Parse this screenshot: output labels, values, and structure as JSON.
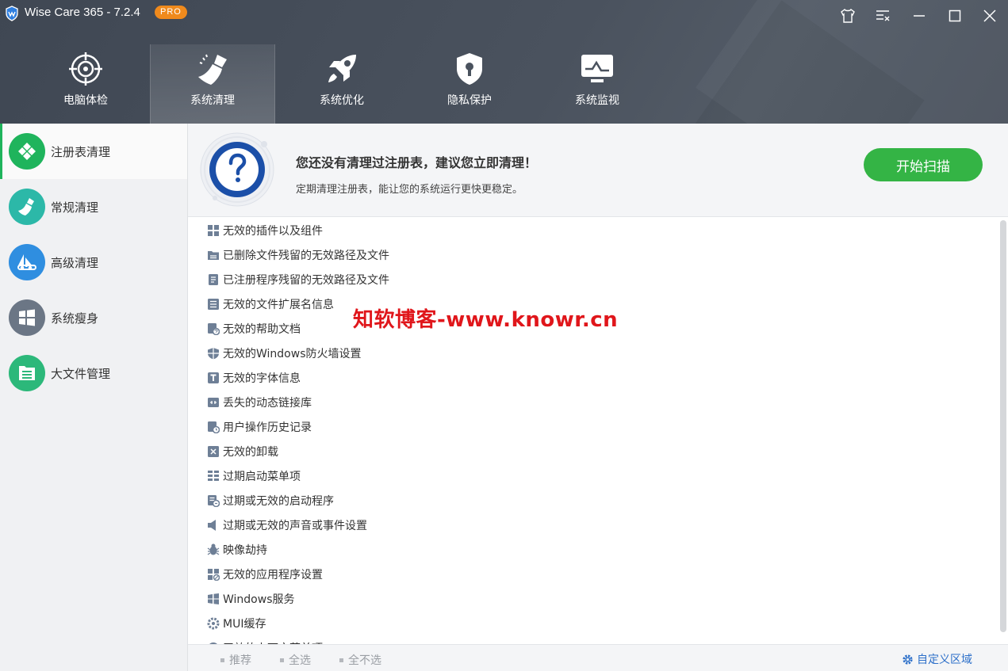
{
  "app": {
    "title": "Wise Care 365 - 7.2.4",
    "badge": "PRO"
  },
  "window_buttons": [
    "skin-icon",
    "menu-icon",
    "minimize-icon",
    "maximize-icon",
    "close-icon"
  ],
  "nav": {
    "tabs": [
      {
        "label": "电脑体检",
        "icon": "target-icon",
        "active": false
      },
      {
        "label": "系统清理",
        "icon": "broom-icon",
        "active": true
      },
      {
        "label": "系统优化",
        "icon": "rocket-icon",
        "active": false
      },
      {
        "label": "隐私保护",
        "icon": "shield-lock-icon",
        "active": false
      },
      {
        "label": "系统监视",
        "icon": "monitor-icon",
        "active": false
      }
    ]
  },
  "sidebar": {
    "items": [
      {
        "label": "注册表清理",
        "color": "#1fb45c",
        "active": true
      },
      {
        "label": "常规清理",
        "color": "#2cb8a8",
        "active": false
      },
      {
        "label": "高级清理",
        "color": "#2f8ee0",
        "active": false
      },
      {
        "label": "系统瘦身",
        "color": "#6b7685",
        "active": false
      },
      {
        "label": "大文件管理",
        "color": "#2cb87a",
        "active": false
      }
    ]
  },
  "banner": {
    "title": "您还没有清理过注册表，建议您立即清理！",
    "subtitle": "定期清理注册表，能让您的系统运行更快更稳定。",
    "scan_button": "开始扫描"
  },
  "items": [
    "无效的插件以及组件",
    "已删除文件残留的无效路径及文件",
    "已注册程序残留的无效路径及文件",
    "无效的文件扩展名信息",
    "无效的帮助文档",
    "无效的Windows防火墙设置",
    "无效的字体信息",
    "丢失的动态链接库",
    "用户操作历史记录",
    "无效的卸载",
    "过期启动菜单项",
    "过期或无效的启动程序",
    "过期或无效的声音或事件设置",
    "映像劫持",
    "无效的应用程序设置",
    "Windows服务",
    "MUI缓存",
    "无效的上下文菜单项"
  ],
  "footer": {
    "recommend": "推荐",
    "select_all": "全选",
    "select_none": "全不选",
    "custom": "自定义区域"
  },
  "watermark": "知软博客-www.knowr.cn",
  "colors": {
    "accent": "#34b445",
    "header": "#464e5a",
    "link": "#2c6fc9",
    "watermark": "#e0161b"
  }
}
